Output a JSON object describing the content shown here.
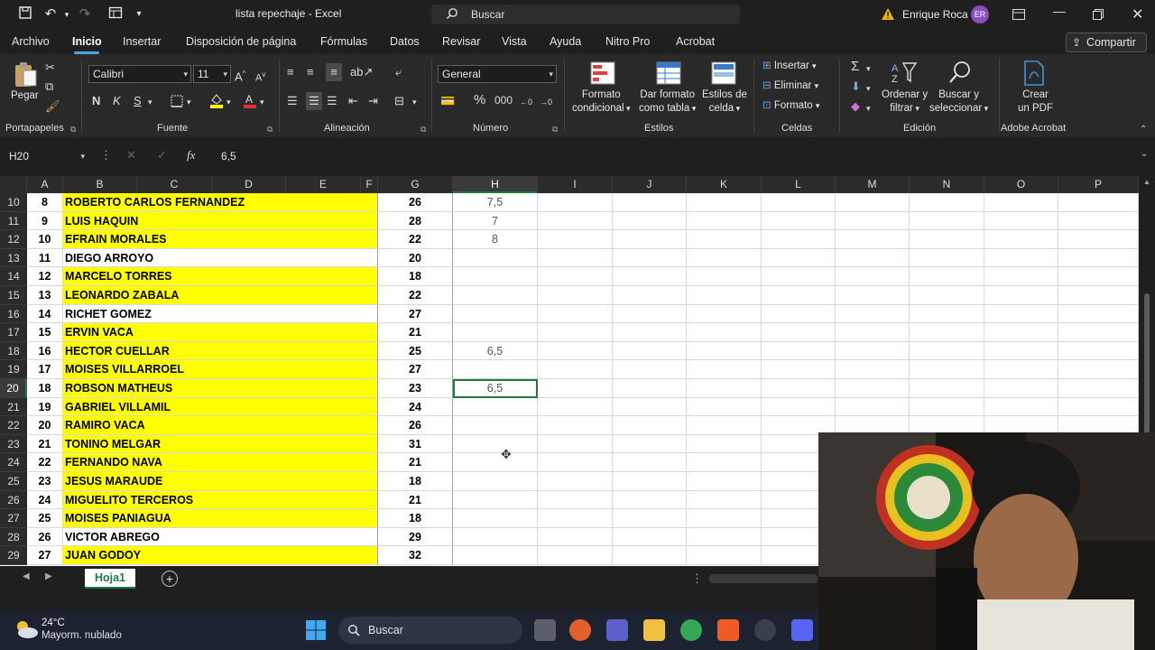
{
  "window": {
    "title": "lista repechaje  -  Excel",
    "search_label": "Buscar",
    "user_name": "Enrique Roca",
    "user_initials": "ER"
  },
  "menu": {
    "tabs": [
      "Archivo",
      "Inicio",
      "Insertar",
      "Disposición de página",
      "Fórmulas",
      "Datos",
      "Revisar",
      "Vista",
      "Ayuda",
      "Nitro Pro",
      "Acrobat"
    ],
    "share_label": "Compartir"
  },
  "ribbon": {
    "paste_label": "Pegar",
    "font_name": "Calibri",
    "font_size": "11",
    "bold": "N",
    "italic": "K",
    "underline": "S",
    "number_format": "General",
    "cond_format_l1": "Formato",
    "cond_format_l2": "condicional",
    "table_format_l1": "Dar formato",
    "table_format_l2": "como tabla",
    "cell_styles_l1": "Estilos de",
    "cell_styles_l2": "celda",
    "insert_label": "Insertar",
    "delete_label": "Eliminar",
    "format_label": "Formato",
    "sort_l1": "Ordenar y",
    "sort_l2": "filtrar",
    "find_l1": "Buscar y",
    "find_l2": "seleccionar",
    "pdf_l1": "Crear",
    "pdf_l2": "un PDF",
    "groups": {
      "clipboard": "Portapapeles",
      "font": "Fuente",
      "alignment": "Alineación",
      "number": "Número",
      "styles": "Estilos",
      "cells": "Celdas",
      "editing": "Edición",
      "acrobat": "Adobe Acrobat"
    }
  },
  "formula_bar": {
    "name_box": "H20",
    "fx": "fx",
    "value": "6,5"
  },
  "columns": [
    "A",
    "B",
    "C",
    "D",
    "E",
    "F",
    "G",
    "H",
    "I",
    "J",
    "K",
    "L",
    "M",
    "N",
    "O",
    "P"
  ],
  "rows": [
    {
      "num": "10",
      "a": "8",
      "name": "ROBERTO CARLOS FERNANDEZ",
      "g": "26",
      "h": "7,5",
      "yellow": true
    },
    {
      "num": "11",
      "a": "9",
      "name": "LUIS HAQUIN",
      "g": "28",
      "h": "7",
      "yellow": true
    },
    {
      "num": "12",
      "a": "10",
      "name": "EFRAIN MORALES",
      "g": "22",
      "h": "8",
      "yellow": true
    },
    {
      "num": "13",
      "a": "11",
      "name": "DIEGO ARROYO",
      "g": "20",
      "h": "",
      "yellow": false
    },
    {
      "num": "14",
      "a": "12",
      "name": "MARCELO TORRES",
      "g": "18",
      "h": "",
      "yellow": true
    },
    {
      "num": "15",
      "a": "13",
      "name": "LEONARDO ZABALA",
      "g": "22",
      "h": "",
      "yellow": true
    },
    {
      "num": "16",
      "a": "14",
      "name": "RICHET GOMEZ",
      "g": "27",
      "h": "",
      "yellow": false
    },
    {
      "num": "17",
      "a": "15",
      "name": "ERVIN VACA",
      "g": "21",
      "h": "",
      "yellow": true
    },
    {
      "num": "18",
      "a": "16",
      "name": "HECTOR CUELLAR",
      "g": "25",
      "h": "6,5",
      "yellow": true
    },
    {
      "num": "19",
      "a": "17",
      "name": "MOISES VILLARROEL",
      "g": "27",
      "h": "",
      "yellow": true
    },
    {
      "num": "20",
      "a": "18",
      "name": "ROBSON MATHEUS",
      "g": "23",
      "h": "6,5",
      "yellow": true
    },
    {
      "num": "21",
      "a": "19",
      "name": "GABRIEL VILLAMIL",
      "g": "24",
      "h": "",
      "yellow": true
    },
    {
      "num": "22",
      "a": "20",
      "name": "RAMIRO VACA",
      "g": "26",
      "h": "",
      "yellow": true
    },
    {
      "num": "23",
      "a": "21",
      "name": "TONINO MELGAR",
      "g": "31",
      "h": "",
      "yellow": true
    },
    {
      "num": "24",
      "a": "22",
      "name": "FERNANDO NAVA",
      "g": "21",
      "h": "",
      "yellow": true
    },
    {
      "num": "25",
      "a": "23",
      "name": "JESUS MARAUDE",
      "g": "18",
      "h": "",
      "yellow": true
    },
    {
      "num": "26",
      "a": "24",
      "name": "MIGUELITO TERCEROS",
      "g": "21",
      "h": "",
      "yellow": true
    },
    {
      "num": "27",
      "a": "25",
      "name": "MOISES PANIAGUA",
      "g": "18",
      "h": "",
      "yellow": true
    },
    {
      "num": "28",
      "a": "26",
      "name": "VICTOR ABREGO",
      "g": "29",
      "h": "",
      "yellow": false
    },
    {
      "num": "29",
      "a": "27",
      "name": "JUAN GODOY",
      "g": "32",
      "h": "",
      "yellow": true
    }
  ],
  "selected_row": "20",
  "sheet_tab": "Hoja1",
  "taskbar": {
    "temperature": "24°C",
    "weather": "Mayorm. nublado",
    "search_label": "Buscar"
  },
  "colors": {
    "highlight": "#ffff00",
    "excel_green": "#1f7a40",
    "accent_blue": "#4fa3e0"
  }
}
